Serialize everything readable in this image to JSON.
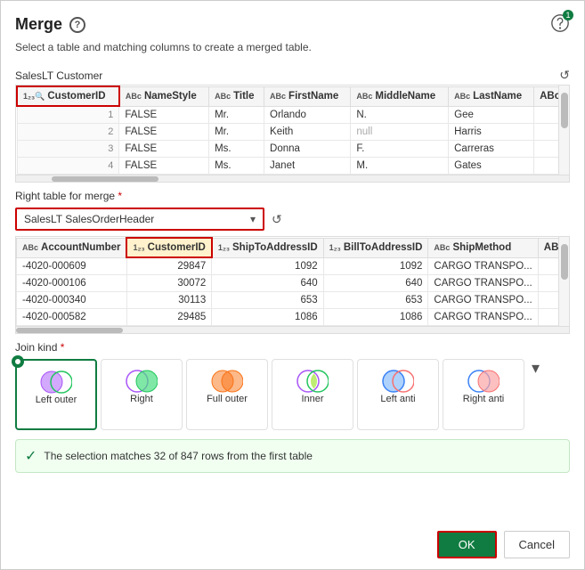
{
  "dialog": {
    "title": "Merge",
    "subtitle": "Select a table and matching columns to create a merged table.",
    "top_table_label": "SalesLT Customer",
    "right_table_label": "Right table for merge",
    "right_table_required": "*",
    "dropdown_value": "SalesLT SalesOrderHeader",
    "match_text_1": "The selection matches 32 of 847 rows from the",
    "match_text_highlight": "first table",
    "ok_label": "OK",
    "cancel_label": "Cancel"
  },
  "top_table": {
    "columns": [
      {
        "type": "12₃🔍",
        "label": "CustomerID"
      },
      {
        "type": "ABc",
        "label": "NameStyle"
      },
      {
        "type": "ABc",
        "label": "Title"
      },
      {
        "type": "ABc",
        "label": "FirstName"
      },
      {
        "type": "ABc",
        "label": "MiddleName"
      },
      {
        "type": "ABc",
        "label": "LastName"
      },
      {
        "type": "ABc",
        "label": "..."
      }
    ],
    "rows": [
      {
        "num": "1",
        "cols": [
          "FALSE",
          "Mr.",
          "Orlando",
          "N.",
          "Gee",
          ""
        ]
      },
      {
        "num": "2",
        "cols": [
          "FALSE",
          "Mr.",
          "Keith",
          "null",
          "Harris",
          ""
        ]
      },
      {
        "num": "3",
        "cols": [
          "FALSE",
          "Ms.",
          "Donna",
          "F.",
          "Carreras",
          ""
        ]
      },
      {
        "num": "4",
        "cols": [
          "FALSE",
          "Ms.",
          "Janet",
          "M.",
          "Gates",
          ""
        ]
      }
    ]
  },
  "bottom_table": {
    "columns": [
      {
        "type": "ABc",
        "label": "AccountNumber"
      },
      {
        "type": "12₃",
        "label": "CustomerID"
      },
      {
        "type": "12₃",
        "label": "ShipToAddressID"
      },
      {
        "type": "12₃",
        "label": "BillToAddressID"
      },
      {
        "type": "ABc",
        "label": "ShipMethod"
      },
      {
        "type": "ABc",
        "label": "..."
      }
    ],
    "rows": [
      {
        "cols": [
          "-4020-000609",
          "29847",
          "1092",
          "1092",
          "CARGO TRANSPO...",
          ""
        ]
      },
      {
        "cols": [
          "-4020-000106",
          "30072",
          "640",
          "640",
          "CARGO TRANSPO...",
          ""
        ]
      },
      {
        "cols": [
          "-4020-000340",
          "30113",
          "653",
          "653",
          "CARGO TRANSPO...",
          ""
        ]
      },
      {
        "cols": [
          "-4020-000582",
          "29485",
          "1086",
          "1086",
          "CARGO TRANSPO...",
          ""
        ]
      }
    ]
  },
  "join_kind": {
    "label": "Join kind",
    "required": "*",
    "options": [
      {
        "id": "left-outer",
        "label": "Left outer",
        "active": true
      },
      {
        "id": "right",
        "label": "Right",
        "active": false
      },
      {
        "id": "full-outer",
        "label": "Full outer",
        "active": false
      },
      {
        "id": "inner",
        "label": "Inner",
        "active": false
      },
      {
        "id": "left-anti",
        "label": "Left anti",
        "active": false
      },
      {
        "id": "right-anti",
        "label": "Right anti",
        "active": false
      }
    ]
  }
}
